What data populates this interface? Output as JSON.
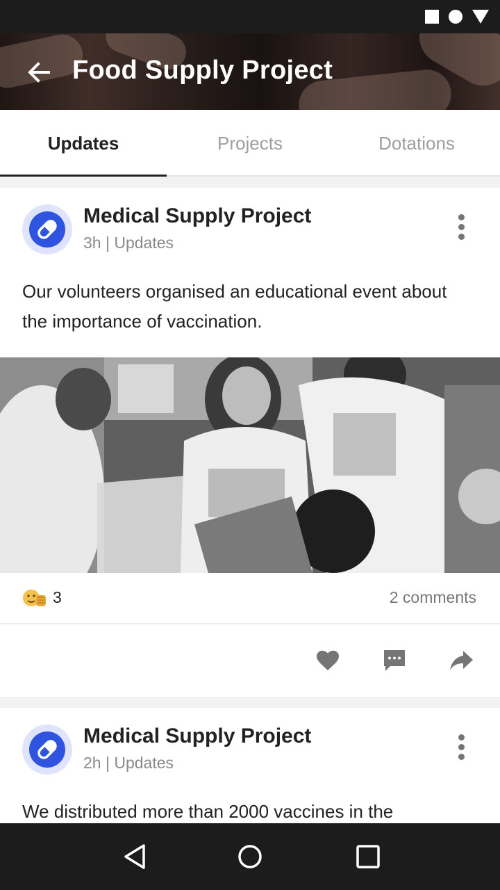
{
  "status_bar": {
    "icons": [
      "square-icon",
      "circle-icon",
      "triangle-icon"
    ]
  },
  "app_bar": {
    "title": "Food Supply Project",
    "back_icon": "arrow-left-icon"
  },
  "tabs": [
    {
      "label": "Updates",
      "active": true
    },
    {
      "label": "Projects",
      "active": false
    },
    {
      "label": "Dotations",
      "active": false
    }
  ],
  "posts": [
    {
      "author": "Medical Supply Project",
      "meta": "3h | Updates",
      "text": "Our volunteers organised an educational event about the importance of vaccination.",
      "reaction_count": "3",
      "comments": "2 comments",
      "avatar_icon": "pill-icon"
    },
    {
      "author": "Medical Supply Project",
      "meta": "2h | Updates",
      "text": "We distributed more than 2000 vaccines in the",
      "avatar_icon": "pill-icon"
    }
  ],
  "actions": [
    "heart-icon",
    "comment-icon",
    "share-icon"
  ],
  "colors": {
    "accent": "#2f55e0",
    "avatar_bg": "#dfe3fb",
    "bar_dark": "#1c1c1c"
  }
}
